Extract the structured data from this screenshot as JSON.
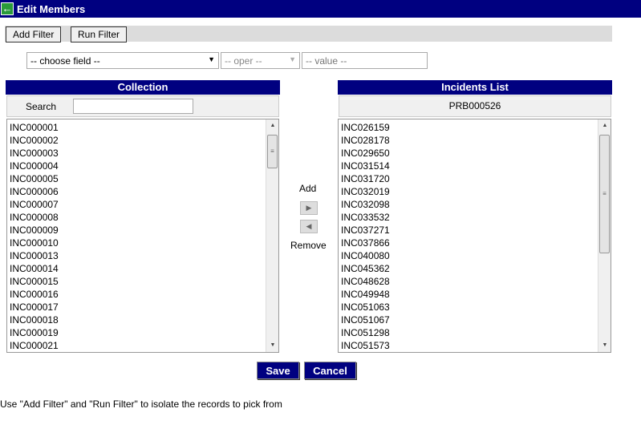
{
  "title": "Edit Members",
  "filter": {
    "add_filter": "Add Filter",
    "run_filter": "Run Filter",
    "field_placeholder": "-- choose field --",
    "oper_placeholder": "-- oper --",
    "value_placeholder": "-- value --"
  },
  "collection": {
    "header": "Collection",
    "search_label": "Search",
    "search_value": "",
    "items": [
      "INC000001",
      "INC000002",
      "INC000003",
      "INC000004",
      "INC000005",
      "INC000006",
      "INC000007",
      "INC000008",
      "INC000009",
      "INC000010",
      "INC000013",
      "INC000014",
      "INC000015",
      "INC000016",
      "INC000017",
      "INC000018",
      "INC000019",
      "INC000021"
    ]
  },
  "incidents": {
    "header": "Incidents List",
    "problem": "PRB000526",
    "items": [
      "INC026159",
      "INC028178",
      "INC029650",
      "INC031514",
      "INC031720",
      "INC032019",
      "INC032098",
      "INC033532",
      "INC037271",
      "INC037866",
      "INC040080",
      "INC045362",
      "INC048628",
      "INC049948",
      "INC051063",
      "INC051067",
      "INC051298",
      "INC051573"
    ]
  },
  "transfer": {
    "add_label": "Add",
    "remove_label": "Remove"
  },
  "actions": {
    "save": "Save",
    "cancel": "Cancel"
  },
  "hint": "Use \"Add Filter\" and \"Run Filter\" to isolate the records to pick from"
}
